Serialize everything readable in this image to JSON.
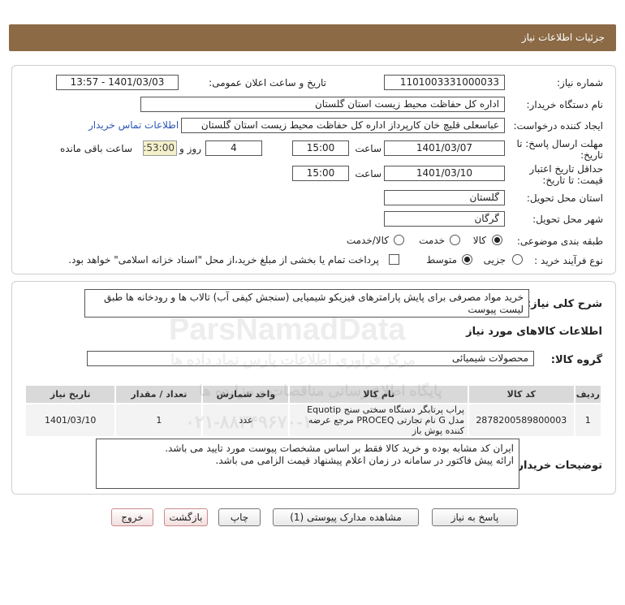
{
  "header": {
    "title": "جزئیات اطلاعات نیاز"
  },
  "form": {
    "need_number_label": "شماره نیاز:",
    "need_number": "1101003331000033",
    "announce_label": "تاریخ و ساعت اعلان عمومی:",
    "announce_value": "1401/03/03 - 13:57",
    "buyer_org_label": "نام دستگاه خریدار:",
    "buyer_org": "اداره کل حفاظت محیط زیست استان گلستان",
    "requester_label": "ایجاد کننده درخواست:",
    "requester": "عباسعلی  قلیچ خان  کارپرداز اداره کل حفاظت محیط زیست استان گلستان",
    "contact_link": "اطلاعات تماس خریدار",
    "deadline_label_1": "مهلت ارسال پاسخ: تا",
    "deadline_label_2": "تاریخ:",
    "deadline_date": "1401/03/07",
    "time_label": "ساعت",
    "deadline_time": "15:00",
    "days_value": "4",
    "days_label": "روز و",
    "remaining_time": "00:53:00",
    "remaining_label": "ساعت باقی مانده",
    "validity_label_1": "حداقل تاریخ اعتبار",
    "validity_label_2": "قیمت: تا تاریخ:",
    "validity_date": "1401/03/10",
    "validity_time": "15:00",
    "province_label": "استان محل تحویل:",
    "province": "گلستان",
    "city_label": "شهر محل تحویل:",
    "city": "گرگان",
    "category_label": "طبقه بندی موضوعی:",
    "category_options": [
      "کالا",
      "خدمت",
      "کالا/خدمت"
    ],
    "process_label": "نوع فرآیند خرید :",
    "process_options": [
      "جزیی",
      "متوسط"
    ],
    "payment_note": "پرداخت تمام یا بخشی از مبلغ خرید،از محل \"اسناد خزانه اسلامی\" خواهد بود."
  },
  "summary": {
    "label": "شرح کلی نیاز:",
    "text": "خرید مواد مصرفی برای پایش پارامترهای فیزیکو شیمیایی (سنجش کیفی آب) تالاب ها و رودخانه ها طبق لیست پیوست",
    "goods_info_title": "اطلاعات کالاهای مورد نیاز",
    "group_label": "گروه کالا:",
    "group_value": "محصولات شیمیائی"
  },
  "table": {
    "headers": [
      "ردیف",
      "کد کالا",
      "نام کالا",
      "واحد شمارش",
      "تعداد / مقدار",
      "تاریخ نیاز"
    ],
    "rows": [
      [
        "1",
        "2878200589800003",
        "پراب پرتابگر دستگاه سختی سنج Equotip مدل G نام تجارتی PROCEQ مرجع عرضه کننده پوش باز",
        "عدد",
        "1",
        "1401/03/10"
      ]
    ]
  },
  "buyer_notes": {
    "label": "توضیحات خریدار:",
    "line1": "ایران کد مشابه بوده و خرید کالا فقط بر اساس مشخصات پیوست مورد تایید می باشد.",
    "line2": "ارائه پیش فاکتور در سامانه در زمان اعلام پیشنهاد قیمت الزامی می باشد."
  },
  "buttons": {
    "reply": "پاسخ به نیاز",
    "attachments": "مشاهده مدارک پیوستی (1)",
    "print": "چاپ",
    "back": "بازگشت",
    "exit": "خروج"
  },
  "watermark": {
    "brand": "ParsNamadData",
    "fa_line1": "مرکز فراوری اطلاعات پارس نماد داده ها",
    "fa_line2": "پایگاه اطلاع رسانی مناقصات و مزایده ها",
    "phone": "۰۲۱-۸۸۳۴۹۶۷۰-۱۰"
  }
}
